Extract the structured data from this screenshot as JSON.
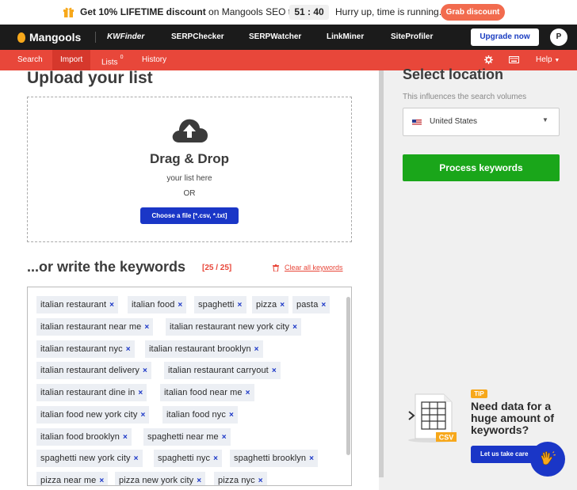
{
  "promo": {
    "bold_text": "Get 10% LIFETIME discount",
    "rest_text": " on Mangools SEO tools!",
    "timer": "51 : 40",
    "hurry": "Hurry up, time is running.",
    "grab_label": "Grab discount"
  },
  "nav": {
    "logo": "Mangools",
    "apps": [
      "KWFinder",
      "SERPChecker",
      "SERPWatcher",
      "LinkMiner",
      "SiteProfiler"
    ],
    "upgrade_label": "Upgrade now",
    "avatar_letter": "P"
  },
  "subnav": {
    "search": "Search",
    "import": "Import",
    "lists": "Lists",
    "lists_badge": "0",
    "history": "History",
    "help": "Help"
  },
  "upload": {
    "title": "Upload your list",
    "drag_drop": "Drag & Drop",
    "your_list": "your list here",
    "or": "OR",
    "choose_label": "Choose a file [*.csv, *.txt]"
  },
  "write": {
    "title": "...or write the keywords",
    "count": "[25 / 25]",
    "clear_label": "Clear all keywords"
  },
  "keywords": [
    "italian restaurant",
    "italian food",
    "spaghetti",
    "pizza",
    "pasta",
    "italian restaurant near me",
    "italian restaurant new york city",
    "italian restaurant nyc",
    "italian restaurant brooklyn",
    "italian restaurant delivery",
    "italian restaurant carryout",
    "italian restaurant dine in",
    "italian food near me",
    "italian food new york city",
    "italian food nyc",
    "italian food brooklyn",
    "spaghetti near me",
    "spaghetti new york city",
    "spaghetti nyc",
    "spaghetti brooklyn",
    "pizza near me",
    "pizza new york city",
    "pizza nyc"
  ],
  "location": {
    "title": "Select location",
    "subtitle": "This influences the search volumes",
    "selected": "United States",
    "process_label": "Process keywords"
  },
  "tip": {
    "badge": "TIP",
    "text": "Need data for a huge amount of keywords?",
    "button_label": "Let us take care",
    "csv_label": "CSV"
  },
  "colors": {
    "accent_red": "#e8473a",
    "primary_blue": "#1a36c7",
    "success_green": "#1aa61a",
    "nav_dark": "#1b1b1b"
  }
}
